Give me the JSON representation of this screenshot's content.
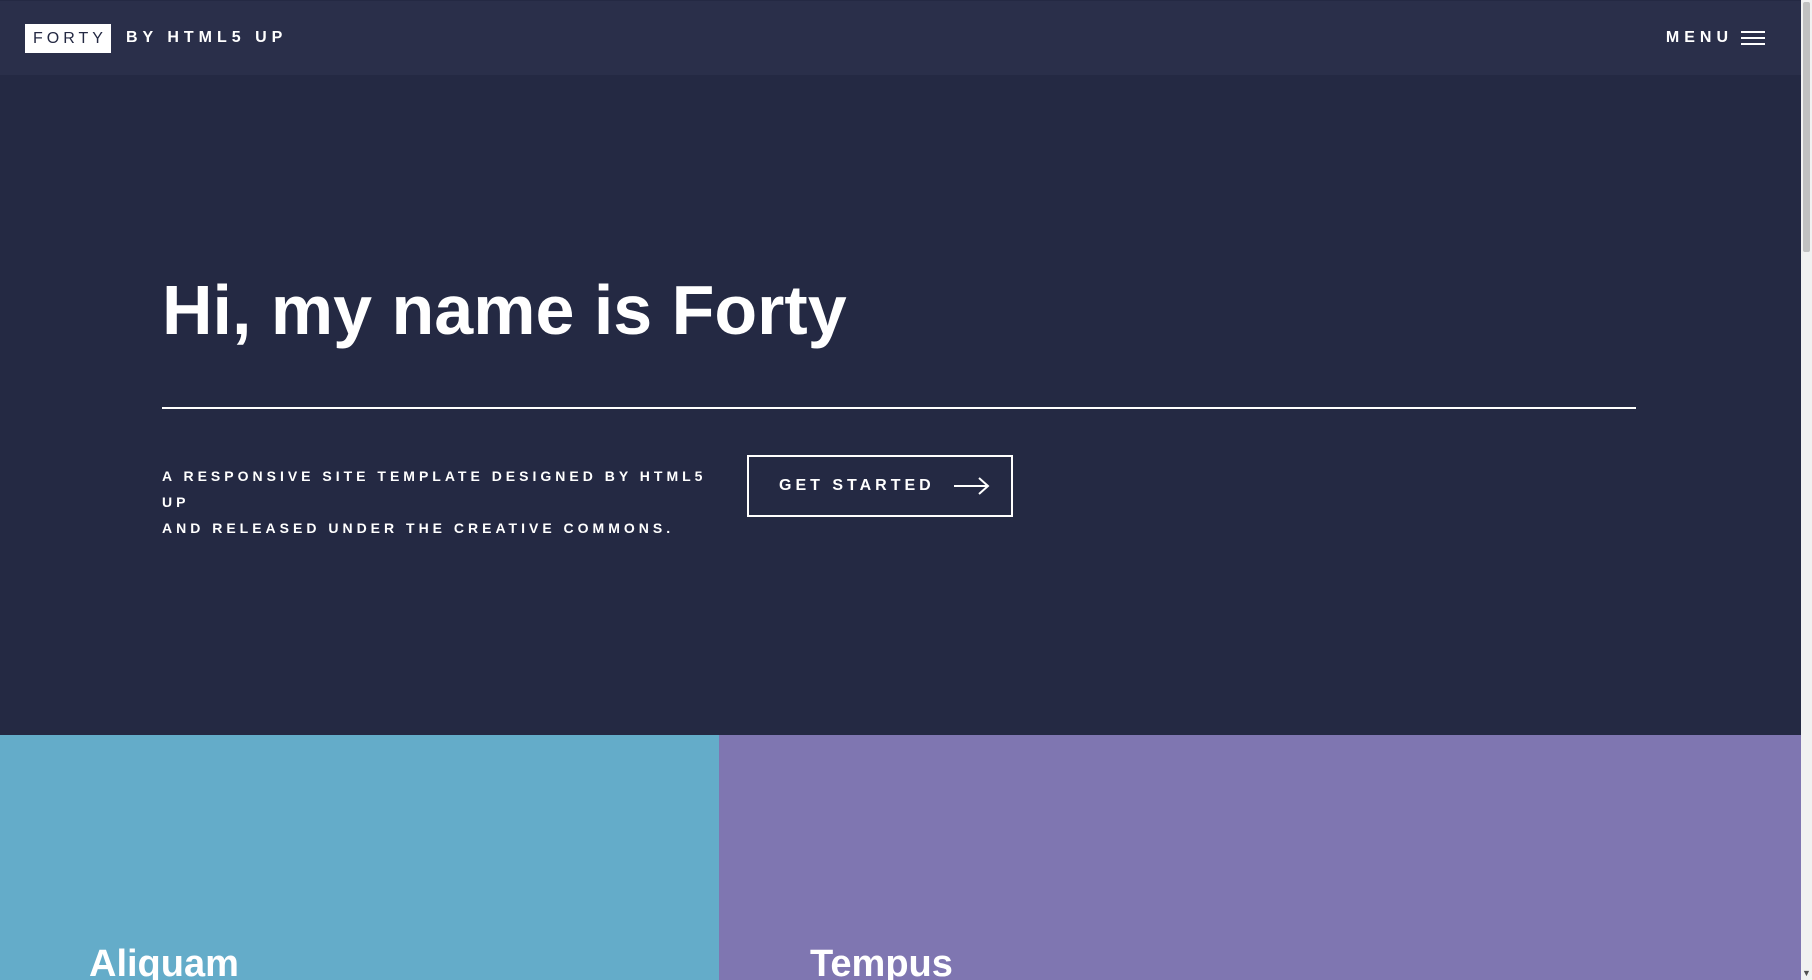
{
  "header": {
    "logo_box": "FORTY",
    "logo_rest": "BY HTML5 UP",
    "menu_label": "MENU"
  },
  "banner": {
    "title": "Hi, my name is Forty",
    "text_line1": "A RESPONSIVE SITE TEMPLATE DESIGNED BY HTML5 UP",
    "text_line2": "AND RELEASED UNDER THE CREATIVE COMMONS.",
    "cta_label": "GET STARTED"
  },
  "tiles": [
    {
      "title": "Aliquam",
      "color": "#64acc9"
    },
    {
      "title": "Tempus",
      "color": "#7f76b1"
    }
  ],
  "colors": {
    "background": "#242943",
    "header": "#2a2f4a",
    "text": "#ffffff"
  },
  "icons": {
    "menu": "hamburger-icon",
    "cta": "arrow-right-icon",
    "scroll_down": "chevron-down-icon"
  }
}
